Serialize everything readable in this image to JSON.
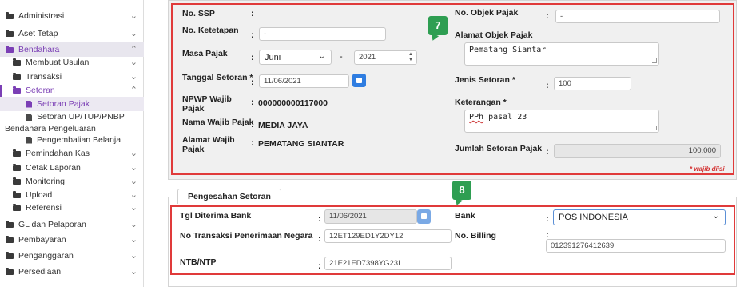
{
  "sidebar": {
    "items": [
      {
        "label": "Administrasi",
        "chev": "⌄"
      },
      {
        "label": "Aset Tetap",
        "chev": "⌄"
      },
      {
        "label": "Bendahara",
        "chev": "⌃"
      },
      {
        "label": "Membuat Usulan",
        "chev": "⌄"
      },
      {
        "label": "Transaksi",
        "chev": "⌄"
      },
      {
        "label": "Setoran",
        "chev": "⌃"
      },
      {
        "label": "Setoran Pajak"
      },
      {
        "label": "Setoran UP/TUP/PNBP",
        "label2": "Bendahara Pengeluaran"
      },
      {
        "label": "Pengembalian Belanja"
      },
      {
        "label": "Pemindahan Kas",
        "chev": "⌄"
      },
      {
        "label": "Cetak Laporan",
        "chev": "⌄"
      },
      {
        "label": "Monitoring",
        "chev": "⌄"
      },
      {
        "label": "Upload",
        "chev": "⌄"
      },
      {
        "label": "Referensi",
        "chev": "⌄"
      },
      {
        "label": "GL dan Pelaporan",
        "chev": "⌄"
      },
      {
        "label": "Pembayaran",
        "chev": "⌄"
      },
      {
        "label": "Penganggaran",
        "chev": "⌄"
      },
      {
        "label": "Persediaan",
        "chev": "⌄"
      }
    ]
  },
  "form": {
    "no_ssp": {
      "label": "No. SSP",
      "value": ""
    },
    "no_ketetapan": {
      "label": "No. Ketetapan",
      "value": "-"
    },
    "masa_pajak": {
      "label": "Masa Pajak",
      "month": "Juni",
      "dash": "-",
      "year": "2021"
    },
    "tanggal_setoran": {
      "label": "Tanggal Setoran *",
      "value": "11/06/2021"
    },
    "npwp": {
      "label": "NPWP Wajib",
      "label2": "Pajak",
      "value": "000000000117000"
    },
    "nama_wajib": {
      "label": "Nama Wajib Pajak",
      "value": "MEDIA JAYA"
    },
    "alamat_wajib": {
      "label": "Alamat Wajib",
      "label2": "Pajak",
      "value": "PEMATANG SIANTAR"
    },
    "no_objek": {
      "label": "No. Objek Pajak",
      "value": "-"
    },
    "alamat_objek": {
      "label": "Alamat Objek Pajak",
      "value": "Pematang Siantar"
    },
    "jenis_setoran": {
      "label": "Jenis Setoran *",
      "value": "100"
    },
    "keterangan": {
      "label": "Keterangan *",
      "value_a": "PPh",
      "value_b": " pasal 23"
    },
    "jumlah_setoran": {
      "label": "Jumlah Setoran Pajak",
      "value": "100.000"
    },
    "wajib_note": "* wajib diisi",
    "colon": ":"
  },
  "badges": {
    "b7": "7",
    "b8": "8"
  },
  "pengesahan": {
    "title": "Pengesahan Setoran",
    "tgl_diterima": {
      "label": "Tgl Diterima Bank",
      "value": "11/06/2021"
    },
    "no_transaksi": {
      "label": "No Transaksi Penerimaan Negara",
      "value": "12ET129ED1Y2DY12"
    },
    "ntb": {
      "label": "NTB/NTP",
      "value": "21E21ED7398YG23I"
    },
    "bank": {
      "label": "Bank",
      "value": "POS INDONESIA"
    },
    "billing": {
      "label": "No. Billing",
      "value": "012391276412639"
    }
  },
  "colors": {
    "accent": "#7b3fb5",
    "highlight": "#e03a3a",
    "badge": "#2e9e52",
    "primary": "#2f7de1"
  }
}
